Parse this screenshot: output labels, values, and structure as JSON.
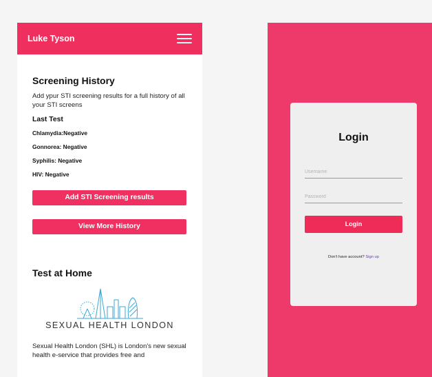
{
  "left": {
    "header": {
      "title": "Luke Tyson"
    },
    "screening": {
      "title": "Screening History",
      "description": "Add ypur STI screening results for a full history of all your STI screens",
      "last_test_label": "Last Test",
      "results": [
        "Chlamydia:Negative",
        "Gonnorea: Negative",
        "Syphilis: Negative",
        "HIV: Negative"
      ],
      "add_button": "Add STI Screening results",
      "history_button": "View More History"
    },
    "home": {
      "title": "Test at Home",
      "logo_text": "SEXUAL HEALTH LONDON",
      "description": "Sexual Health London (SHL) is London's new sexual health e-service that provides free and"
    }
  },
  "right": {
    "login": {
      "title": "Login",
      "username_placeholder": "Username",
      "password_placeholder": "Password",
      "button": "Login",
      "no_account_text": "Don't have account?",
      "signup_link": "Sign up"
    }
  },
  "colors": {
    "brand_pink": "#ef305f",
    "login_background": "#ee3a6b",
    "logo_blue": "#3aa7d6"
  },
  "icons": {
    "menu": "hamburger-menu-icon",
    "logo": "london-skyline-logo"
  }
}
